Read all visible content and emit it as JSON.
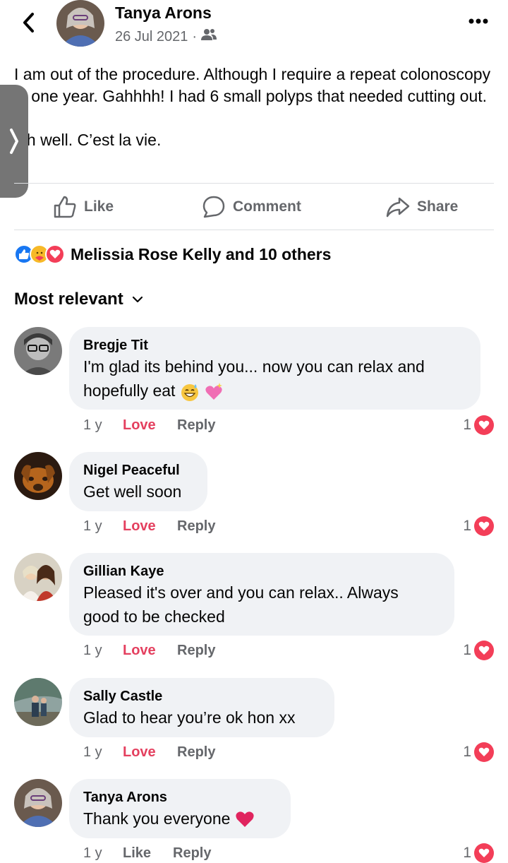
{
  "header": {
    "author": "Tanya Arons",
    "date": "26 Jul 2021",
    "separator": "·",
    "icons": {
      "back": "back-chevron-icon",
      "audience": "friends-icon",
      "more": "more-dots-icon"
    }
  },
  "post": {
    "text": "I am out of the procedure.  Although I require a repeat colonoscopy in one year.  Gahhhh!  I had 6 small polyps that needed cutting out.\n\nOh well.  C’est la vie."
  },
  "actions": {
    "like": "Like",
    "comment": "Comment",
    "share": "Share"
  },
  "reactions": {
    "summary": "Melissia Rose Kelly and 10 others",
    "icons": [
      "like-reaction-icon",
      "care-reaction-icon",
      "love-reaction-icon"
    ]
  },
  "sort": {
    "label": "Most relevant"
  },
  "comments": [
    {
      "name": "Bregje Tit",
      "line1": "I'm glad its behind you... now you can relax and",
      "line2": "hopefully eat",
      "time": "1 y",
      "reaction_action": "Love",
      "reply": "Reply",
      "count": "1"
    },
    {
      "name": "Nigel Peaceful",
      "line1": "Get well soon",
      "time": "1 y",
      "reaction_action": "Love",
      "reply": "Reply",
      "count": "1"
    },
    {
      "name": "Gillian Kaye",
      "line1": "Pleased it's over and you can relax..  Always",
      "line2": "good to be checked",
      "time": "1 y",
      "reaction_action": "Love",
      "reply": "Reply",
      "count": "1"
    },
    {
      "name": "Sally Castle",
      "line1": "Glad to hear you’re ok hon xx",
      "time": "1 y",
      "reaction_action": "Love",
      "reply": "Reply",
      "count": "1"
    },
    {
      "name": "Tanya Arons",
      "line1": "Thank you everyone",
      "time": "1 y",
      "reaction_action": "Like",
      "reply": "Reply",
      "count": "1"
    }
  ],
  "colors": {
    "love": "#e4405f",
    "muted": "#65676b",
    "bubble": "#f0f2f5",
    "like_blue": "#1877f2"
  }
}
